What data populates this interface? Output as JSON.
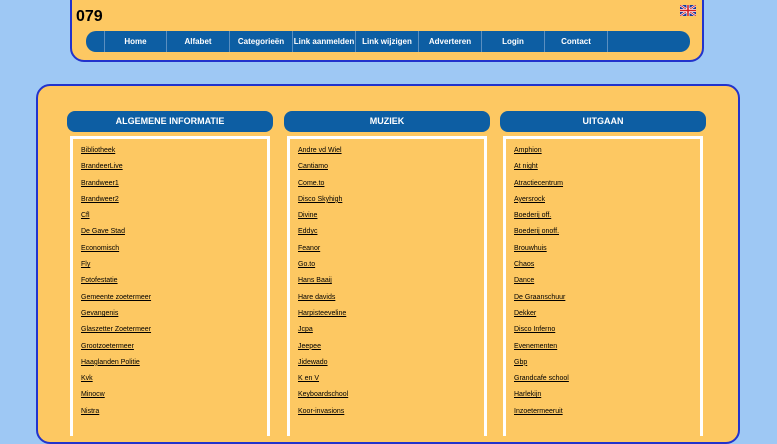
{
  "header": {
    "title": "079",
    "language_icon": "uk-flag-icon"
  },
  "nav": [
    {
      "label": "Home"
    },
    {
      "label": "Alfabet"
    },
    {
      "label": "Categorieën"
    },
    {
      "label": "Link aanmelden"
    },
    {
      "label": "Link wijzigen"
    },
    {
      "label": "Adverteren"
    },
    {
      "label": "Login"
    },
    {
      "label": "Contact"
    }
  ],
  "columns": [
    {
      "title": "ALGEMENE INFORMATIE",
      "links": [
        "Bibliotheek",
        "BrandeerLive",
        "Brandweer1",
        "Brandweer2",
        "Cfl",
        "De Gave Stad",
        "Economisch",
        "Fly",
        "Fotofestatie",
        "Gemeente zoetermeer",
        "Gevangenis",
        "Glaszetter Zoetermeer",
        "Grootzoetermeer",
        "Haaglanden Politie",
        "Kvk",
        "Minocw",
        "Nistra"
      ]
    },
    {
      "title": "MUZIEK",
      "links": [
        "Andre vd Wiel",
        "Cantiamo",
        "Come.to",
        "Disco Skyhigh",
        "Divine",
        "Eddyc",
        "Feanor",
        "Go.to",
        "Hans Baaij",
        "Hare davids",
        "Harpisteeveline",
        "Jcpa",
        "Jeepee",
        "Jidewado",
        "K en V",
        "Keyboardschool",
        "Koor-invasions"
      ]
    },
    {
      "title": "UITGAAN",
      "links": [
        "Amphion",
        "At night",
        "Atractiecentrum",
        "Ayersrock",
        "Boederij off.",
        "Boederij onoff.",
        "Brouwhuis",
        "Chaos",
        "Dance",
        "De Graanschuur",
        "Dekker",
        "Disco Inferno",
        "Evenementen",
        "Gbp",
        "Grandcafe school",
        "Harlekijn",
        "Inzoetermeeruit"
      ]
    }
  ],
  "colors": {
    "background": "#9ec8f4",
    "panel": "#fdc862",
    "navbar": "#0d5ea3",
    "border": "#2233cc"
  }
}
